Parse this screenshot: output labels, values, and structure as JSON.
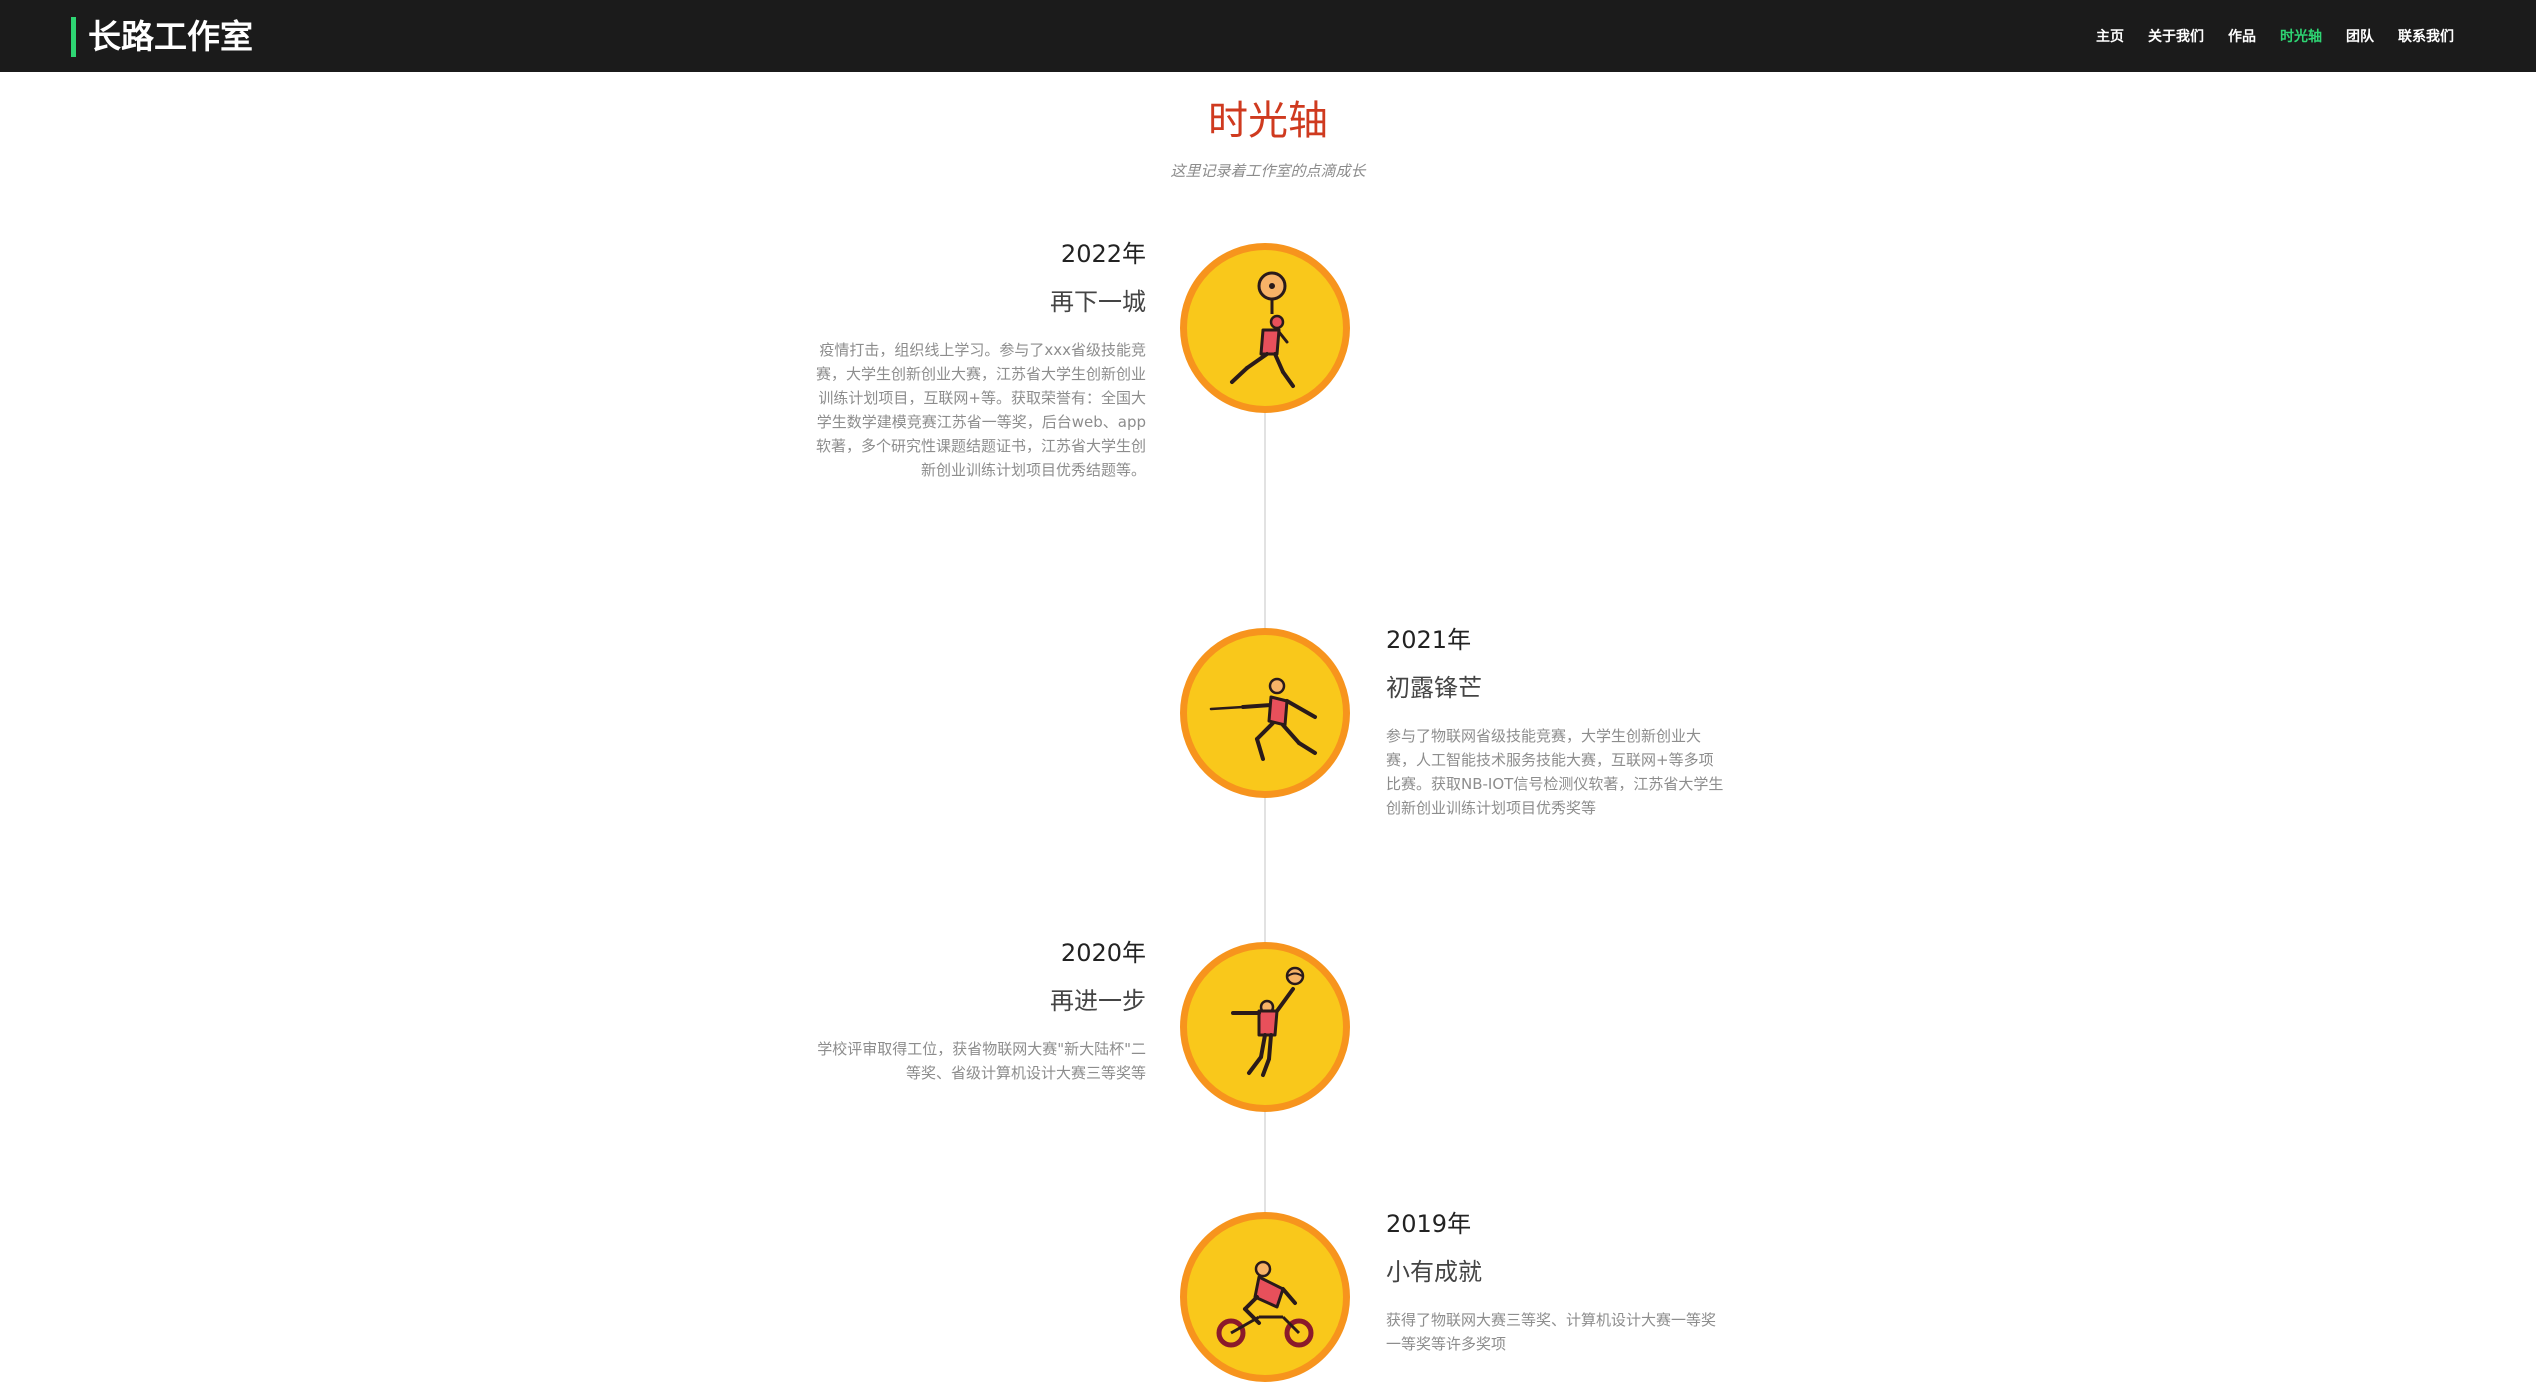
{
  "brand": {
    "name": "长路工作室"
  },
  "nav": {
    "items": [
      {
        "label": "主页",
        "active": false
      },
      {
        "label": "关于我们",
        "active": false
      },
      {
        "label": "作品",
        "active": false
      },
      {
        "label": "时光轴",
        "active": true
      },
      {
        "label": "团队",
        "active": false
      },
      {
        "label": "联系我们",
        "active": false
      }
    ]
  },
  "timeline": {
    "title": "时光轴",
    "subtitle": "这里记录着工作室的点滴成长",
    "entries": [
      {
        "year": "2022年",
        "title": "再下一城",
        "description": "疫情打击，组织线上学习。参与了xxx省级技能竞赛，大学生创新创业大赛，江苏省大学生创新创业训练计划项目，互联网+等。获取荣誉有：全国大学生数学建模竞赛江苏省一等奖，后台web、app软著，多个研究性课题结题证书，江苏省大学生创新创业训练计划项目优秀结题等。",
        "icon": "weightlifting-icon"
      },
      {
        "year": "2021年",
        "title": "初露锋芒",
        "description": "参与了物联网省级技能竞赛，大学生创新创业大赛，人工智能技术服务技能大赛，互联网+等多项比赛。获取NB-IOT信号检测仪软著，江苏省大学生创新创业训练计划项目优秀奖等",
        "icon": "fencing-icon"
      },
      {
        "year": "2020年",
        "title": "再进一步",
        "description": "学校评审取得工位，获省物联网大赛\"新大陆杯\"二等奖、省级计算机设计大赛三等奖等",
        "icon": "volleyball-icon"
      },
      {
        "year": "2019年",
        "title": "小有成就",
        "description": "获得了物联网大赛三等奖、计算机设计大赛一等奖一等奖等许多奖项",
        "icon": "cycling-icon"
      }
    ]
  },
  "colors": {
    "navbar_bg": "#1b1b1b",
    "accent_green": "#2ed573",
    "title_red": "#cf3a1f",
    "badge_fill": "#f9c81b",
    "badge_ring": "#f7941d",
    "figure_red": "#e8505b"
  }
}
